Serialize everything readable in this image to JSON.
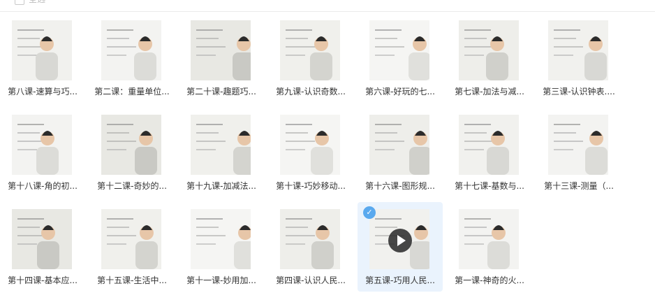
{
  "toolbar": {
    "select_all_label": "全选"
  },
  "files": [
    {
      "title": "第八课-速算与巧..."
    },
    {
      "title": "第二课：重量单位..."
    },
    {
      "title": "第二十课-趣题巧..."
    },
    {
      "title": "第九课-认识奇数..."
    },
    {
      "title": "第六课-好玩的七..."
    },
    {
      "title": "第七课-加法与减..."
    },
    {
      "title": "第三课-认识钟表...."
    },
    {
      "title": "第十八课-角的初..."
    },
    {
      "title": "第十二课-奇妙的..."
    },
    {
      "title": "第十九课-加减法..."
    },
    {
      "title": "第十课-巧妙移动..."
    },
    {
      "title": "第十六课-图形规..."
    },
    {
      "title": "第十七课-基数与..."
    },
    {
      "title": "第十三课-测量（..."
    },
    {
      "title": "第十四课-基本应..."
    },
    {
      "title": "第十五课-生活中..."
    },
    {
      "title": "第十一课-妙用加..."
    },
    {
      "title": "第四课-认识人民..."
    },
    {
      "title": "第五课-巧用人民...",
      "selected": true
    },
    {
      "title": "第一课-神奇的火..."
    }
  ],
  "icons": {
    "check": "checkmark-icon",
    "play": "play-icon"
  }
}
